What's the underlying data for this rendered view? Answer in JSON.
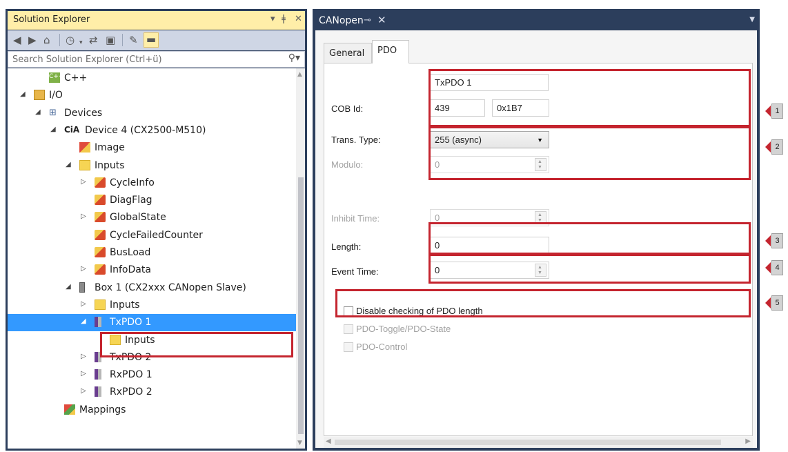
{
  "solution_explorer": {
    "title": "Solution Explorer",
    "search_placeholder": "Search Solution Explorer (Ctrl+ü)",
    "tree": [
      {
        "label": "C++",
        "level": 1,
        "expander": "",
        "icon": "cpp-icon"
      },
      {
        "label": "I/O",
        "level": 0,
        "expander": "◢",
        "icon": "io-icon"
      },
      {
        "label": "Devices",
        "level": 1,
        "expander": "◢",
        "icon": "devices-icon"
      },
      {
        "label": "Device 4 (CX2500-M510)",
        "level": 2,
        "expander": "◢",
        "icon": "cia-device-icon"
      },
      {
        "label": "Image",
        "level": 3,
        "expander": "",
        "icon": "image-icon"
      },
      {
        "label": "Inputs",
        "level": 3,
        "expander": "◢",
        "icon": "folder-icon"
      },
      {
        "label": "CycleInfo",
        "level": 4,
        "expander": "▷",
        "icon": "variable-icon"
      },
      {
        "label": "DiagFlag",
        "level": 4,
        "expander": "",
        "icon": "variable-icon"
      },
      {
        "label": "GlobalState",
        "level": 4,
        "expander": "▷",
        "icon": "variable-icon"
      },
      {
        "label": "CycleFailedCounter",
        "level": 4,
        "expander": "",
        "icon": "variable-icon"
      },
      {
        "label": "BusLoad",
        "level": 4,
        "expander": "",
        "icon": "variable-icon"
      },
      {
        "label": "InfoData",
        "level": 4,
        "expander": "▷",
        "icon": "variable-icon"
      },
      {
        "label": "Box 1 (CX2xxx CANopen Slave)",
        "level": 3,
        "expander": "◢",
        "icon": "box-icon"
      },
      {
        "label": "Inputs",
        "level": 4,
        "expander": "▷",
        "icon": "folder-icon"
      },
      {
        "label": "TxPDO 1",
        "level": 4,
        "expander": "◢",
        "icon": "txpdo-icon",
        "selected": true
      },
      {
        "label": "Inputs",
        "level": 5,
        "expander": "",
        "icon": "folder-icon"
      },
      {
        "label": "TxPDO 2",
        "level": 4,
        "expander": "▷",
        "icon": "txpdo-icon"
      },
      {
        "label": "RxPDO 1",
        "level": 4,
        "expander": "▷",
        "icon": "rxpdo-icon"
      },
      {
        "label": "RxPDO 2",
        "level": 4,
        "expander": "▷",
        "icon": "rxpdo-icon"
      },
      {
        "label": "Mappings",
        "level": 2,
        "expander": "",
        "icon": "mappings-icon"
      }
    ]
  },
  "document": {
    "tab_title": "CANopen",
    "inner_tabs": [
      "General",
      "PDO"
    ],
    "active_inner_tab": "PDO",
    "pdo": {
      "name_value": "TxPDO 1",
      "cob_id_label": "COB Id:",
      "cob_id_dec": "439",
      "cob_id_hex": "0x1B7",
      "trans_type_label": "Trans. Type:",
      "trans_type_value": "255 (async)",
      "modulo_label": "Modulo:",
      "modulo_value": "0",
      "inhibit_label": "Inhibit Time:",
      "inhibit_value": "0",
      "length_label": "Length:",
      "length_value": "0",
      "event_label": "Event Time:",
      "event_value": "0",
      "disable_check_label": "Disable checking of PDO length",
      "toggle_label": "PDO-Toggle/PDO-State",
      "control_label": "PDO-Control"
    }
  },
  "callouts": [
    "1",
    "2",
    "3",
    "4",
    "5"
  ],
  "colors": {
    "highlight": "#c4242e",
    "selection": "#3399ff",
    "title_active": "#ffeea8",
    "frame_dark": "#2c3e5c"
  }
}
